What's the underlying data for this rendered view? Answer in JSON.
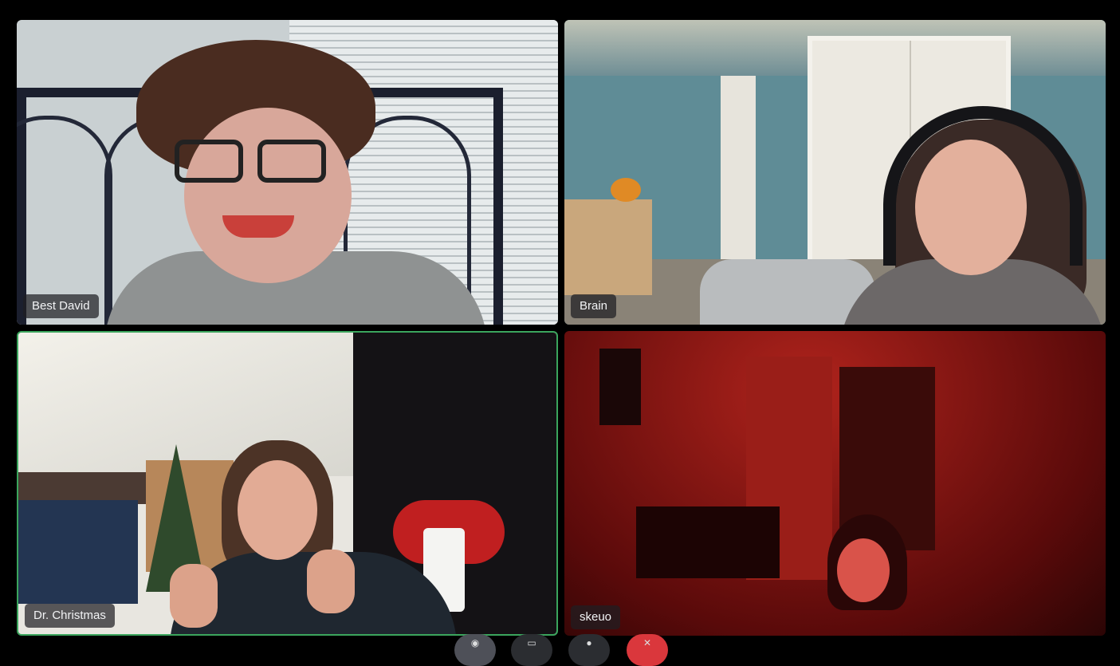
{
  "participants": [
    {
      "name": "Best David",
      "speaking": false
    },
    {
      "name": "Brain",
      "speaking": false
    },
    {
      "name": "Dr. Christmas",
      "speaking": true
    },
    {
      "name": "skeuo",
      "speaking": false
    }
  ],
  "controls": {
    "camera_icon": "camera-icon",
    "screen_icon": "screen-share-icon",
    "activity_icon": "activity-icon",
    "leave_icon": "leave-call-icon"
  },
  "colors": {
    "speaking_border": "#3ba55d",
    "leave_button": "#da373c",
    "background": "#000000"
  }
}
